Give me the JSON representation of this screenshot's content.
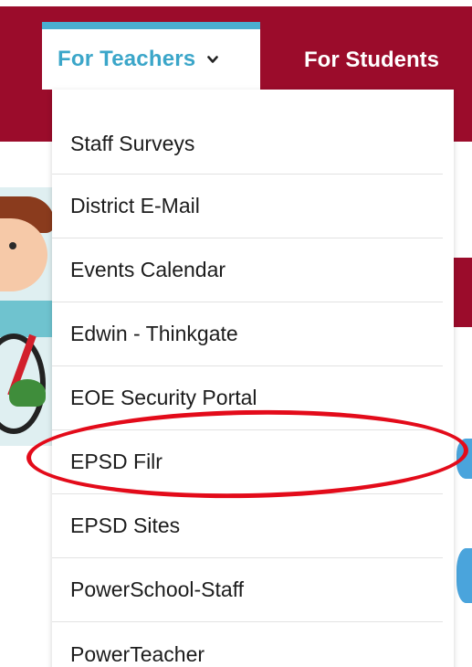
{
  "nav": {
    "tabs": [
      {
        "label": "For Teachers",
        "active": true
      },
      {
        "label": "For Students",
        "active": false
      }
    ],
    "bar_color": "#9b0c2b",
    "active_tab_accent": "#4aaed1",
    "active_tab_icon": "chevron-down-icon"
  },
  "dropdown": {
    "items": [
      {
        "label": "Staff Surveys"
      },
      {
        "label": "District E-Mail"
      },
      {
        "label": "Events Calendar"
      },
      {
        "label": "Edwin - Thinkgate"
      },
      {
        "label": "EOE Security Portal"
      },
      {
        "label": "EPSD Filr",
        "highlighted": true
      },
      {
        "label": "EPSD Sites"
      },
      {
        "label": "PowerSchool-Staff"
      },
      {
        "label": "PowerTeacher"
      }
    ]
  },
  "annotation": {
    "color": "#e30b1a",
    "target": "EPSD Filr"
  }
}
